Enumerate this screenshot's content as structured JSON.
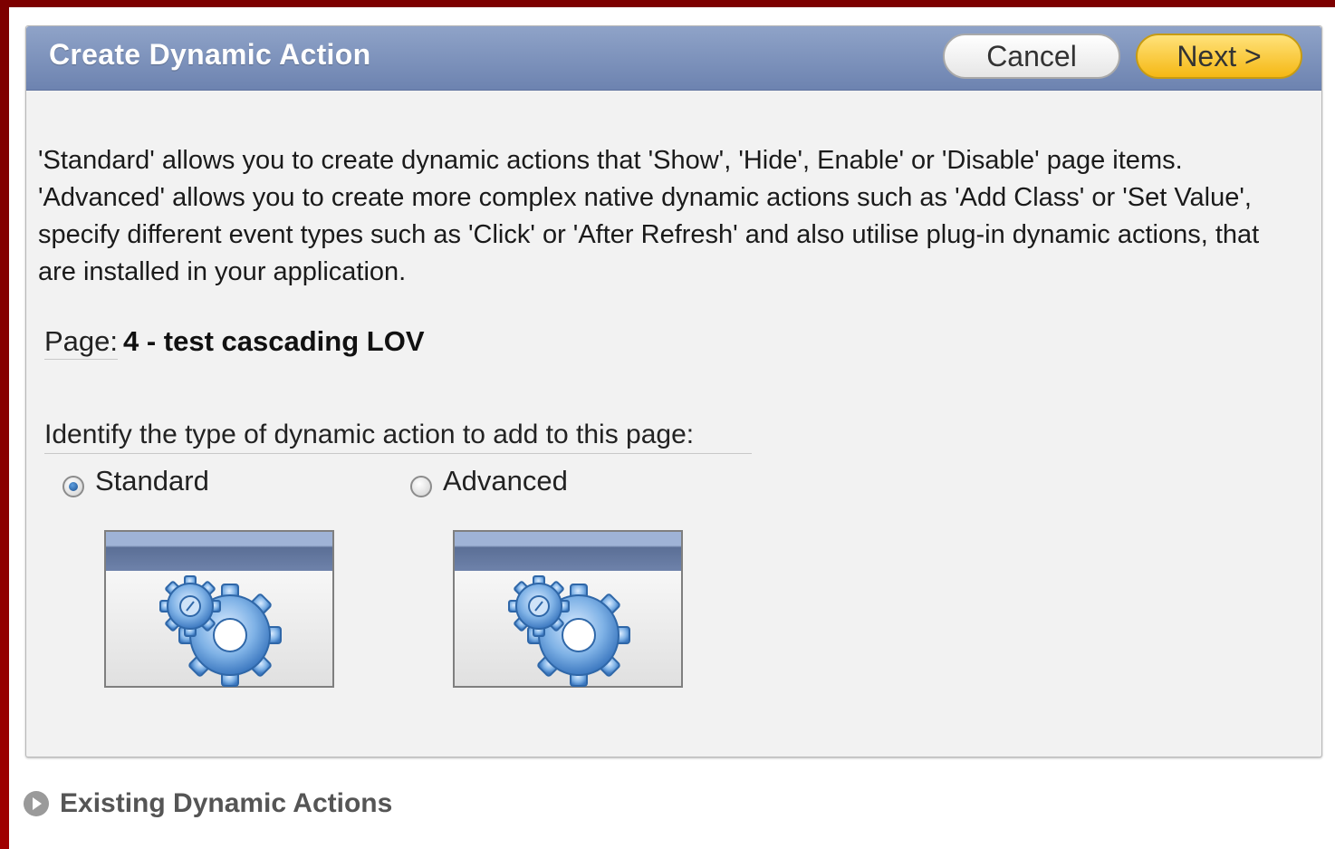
{
  "panel": {
    "title": "Create Dynamic Action",
    "cancel_label": "Cancel",
    "next_label": "Next >",
    "description": "'Standard' allows you to create dynamic actions that 'Show', 'Hide', Enable' or 'Disable' page items. 'Advanced' allows you to create more complex native dynamic actions such as 'Add Class' or 'Set Value', specify different event types such as 'Click' or 'After Refresh' and also utilise plug-in dynamic actions, that are installed in your application.",
    "page_label": "Page:",
    "page_value": "4 - test cascading LOV",
    "identify_label": "Identify the type of dynamic action to add to this page:",
    "options": [
      {
        "label": "Standard",
        "selected": true,
        "icon": "gear-icon"
      },
      {
        "label": "Advanced",
        "selected": false,
        "icon": "gear-icon"
      }
    ]
  },
  "existing": {
    "label": "Existing Dynamic Actions",
    "icon": "arrow-right-circle-icon"
  },
  "colors": {
    "frame": "#7d0000",
    "header": "#6d83b0",
    "next_button": "#f5b814"
  }
}
